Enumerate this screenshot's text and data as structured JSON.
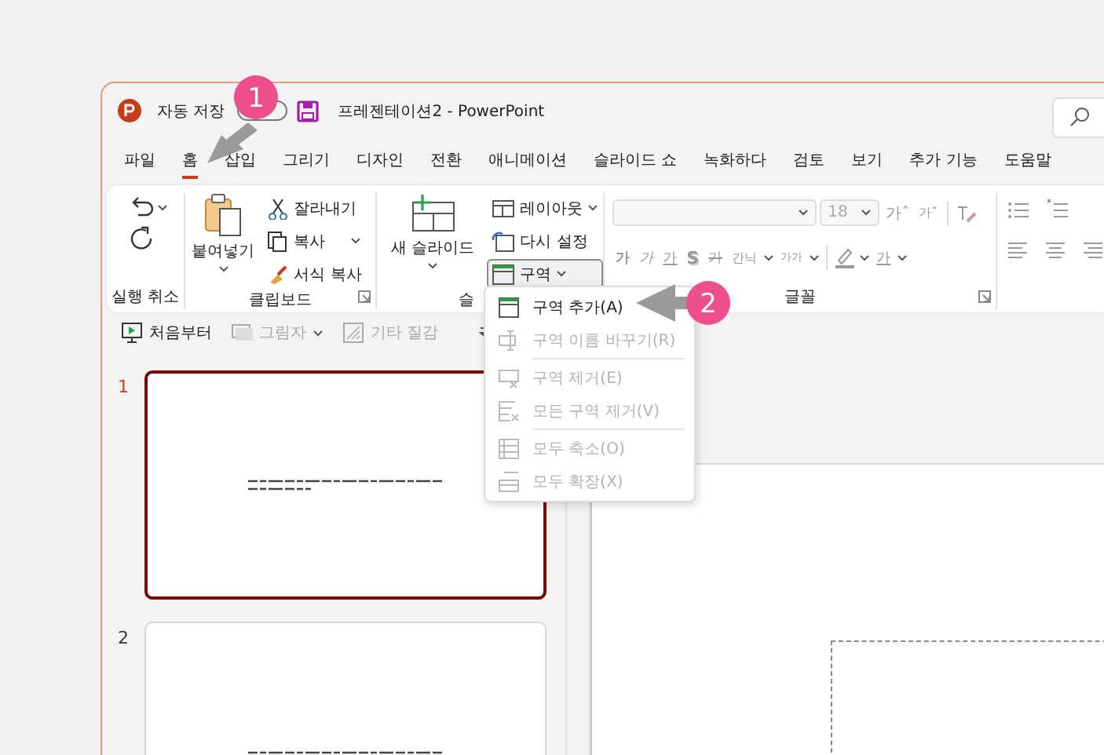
{
  "app": {
    "autosave": {
      "label": "자동 저장",
      "on": false
    },
    "title": "프레젠테이션2  -  PowerPoint"
  },
  "tabs": [
    {
      "label": "파일",
      "selected": false
    },
    {
      "label": "홈",
      "selected": true
    },
    {
      "label": "삽입",
      "selected": false
    },
    {
      "label": "그리기",
      "selected": false
    },
    {
      "label": "디자인",
      "selected": false
    },
    {
      "label": "전환",
      "selected": false
    },
    {
      "label": "애니메이션",
      "selected": false
    },
    {
      "label": "슬라이드 쇼",
      "selected": false
    },
    {
      "label": "녹화하다",
      "selected": false
    },
    {
      "label": "검토",
      "selected": false
    },
    {
      "label": "보기",
      "selected": false
    },
    {
      "label": "추가 기능",
      "selected": false
    },
    {
      "label": "도움말",
      "selected": false
    }
  ],
  "undo_group": {
    "label": "실행 취소"
  },
  "clipboard": {
    "label": "클립보드",
    "paste": "붙여넣기",
    "items": [
      {
        "kind": "cut",
        "label": "잘라내기",
        "dropdown": false
      },
      {
        "kind": "copy",
        "label": "복사",
        "dropdown": true
      },
      {
        "kind": "format",
        "label": "서식 복사",
        "dropdown": false
      }
    ]
  },
  "slides_group": {
    "label": "슬",
    "new_slide": "새 슬라이드",
    "items": [
      {
        "kind": "layout",
        "label": "레이아웃",
        "dropdown": true,
        "pressed": false
      },
      {
        "kind": "reset",
        "label": "다시 설정",
        "dropdown": false,
        "pressed": false
      },
      {
        "kind": "section",
        "label": "구역",
        "dropdown": true,
        "pressed": true
      }
    ]
  },
  "font_group": {
    "label": "글꼴",
    "disabled": true,
    "font_size": "18",
    "top_buttons": [
      {
        "kind": "grow",
        "label": "가ˆ"
      },
      {
        "kind": "shrink",
        "label": "가ˇ"
      }
    ],
    "format_buttons": [
      {
        "kind": "bold",
        "label": "가"
      },
      {
        "kind": "italic",
        "label": "가"
      },
      {
        "kind": "underline",
        "label": "가"
      },
      {
        "kind": "shadow",
        "label": "S"
      },
      {
        "kind": "strike",
        "label": "가"
      },
      {
        "kind": "spacing",
        "label": "간닉"
      },
      {
        "kind": "case",
        "label": "가가"
      }
    ],
    "color_label": "가"
  },
  "quick_access": [
    {
      "kind": "start",
      "label": "처음부터",
      "disabled": false,
      "dropdown": false
    },
    {
      "kind": "shadow",
      "label": "그림자",
      "disabled": true,
      "dropdown": true
    },
    {
      "kind": "texture",
      "label": "기타 질감",
      "disabled": true,
      "dropdown": false
    }
  ],
  "slides": [
    {
      "number": "1",
      "selected": true
    },
    {
      "number": "2",
      "selected": false
    }
  ],
  "section_menu": [
    {
      "kind": "add",
      "label": "구역 추가(A)",
      "disabled": false,
      "separator_before": false
    },
    {
      "kind": "rename",
      "label": "구역 이름 바꾸기(R)",
      "disabled": true,
      "separator_before": false
    },
    {
      "kind": "remove",
      "label": "구역 제거(E)",
      "disabled": true,
      "separator_before": true
    },
    {
      "kind": "remove_all",
      "label": "모든 구역 제거(V)",
      "disabled": true,
      "separator_before": false
    },
    {
      "kind": "collapse",
      "label": "모두 축소(O)",
      "disabled": true,
      "separator_before": true
    },
    {
      "kind": "expand",
      "label": "모두 확장(X)",
      "disabled": true,
      "separator_before": false
    }
  ],
  "callouts": [
    {
      "number": "1"
    },
    {
      "number": "2"
    }
  ]
}
